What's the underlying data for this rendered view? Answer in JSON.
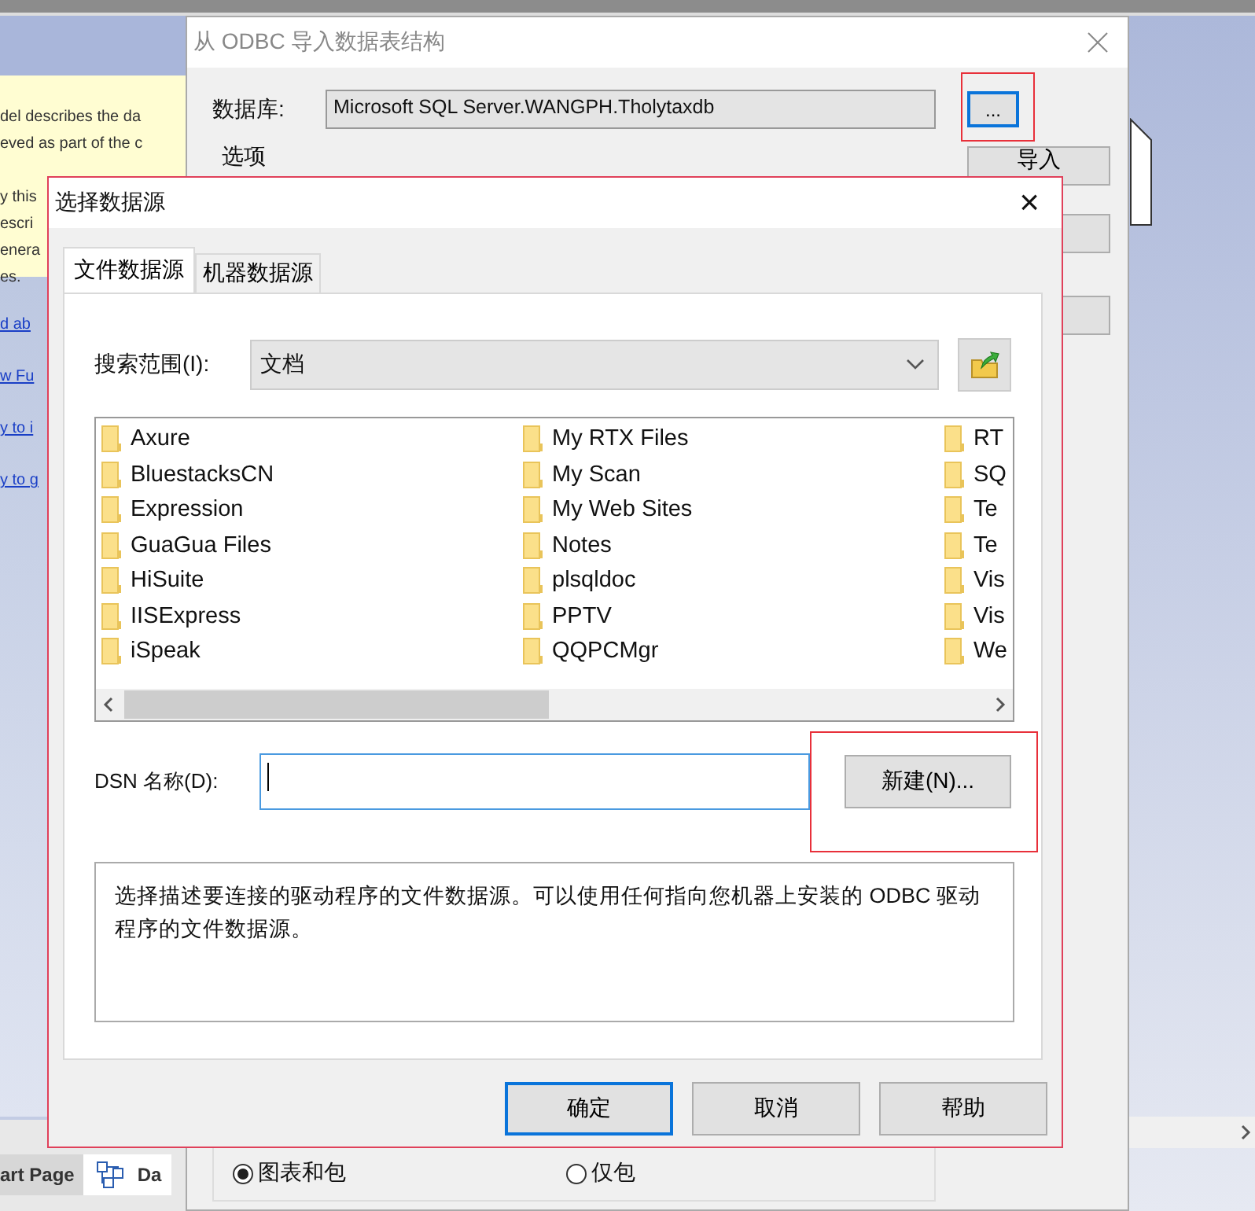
{
  "background_app": {
    "note_paragraphs": [
      [
        "del describes the da",
        "eved as part of the c"
      ],
      [
        "y this",
        "escri",
        "enera",
        "es."
      ]
    ],
    "links": [
      "d ab",
      "w Fu",
      "y to i",
      "y to g"
    ],
    "tabs": [
      {
        "label": "art Page",
        "selected": false
      },
      {
        "label": "Da",
        "selected": true
      }
    ]
  },
  "import_dialog": {
    "title": "从 ODBC 导入数据表结构",
    "database_label": "数据库:",
    "database_value": "Microsoft SQL Server.WANGPH.Tholytaxdb",
    "browse_button": "...",
    "options_label": "选项",
    "import_button": "导入",
    "radios": [
      {
        "label": "图表和包",
        "selected": true
      },
      {
        "label": "仅包",
        "selected": false
      }
    ]
  },
  "datasource_dialog": {
    "title": "选择数据源",
    "close": "×",
    "tabs": [
      {
        "label": "文件数据源",
        "selected": true
      },
      {
        "label": "机器数据源",
        "selected": false
      }
    ],
    "look_in_label": "搜索范围(I):",
    "look_in_value": "文档",
    "files": [
      "Axure",
      "BluestacksCN",
      "Expression",
      "GuaGua Files",
      "HiSuite",
      "IISExpress",
      "iSpeak",
      "My RTX Files",
      "My Scan",
      "My Web Sites",
      "Notes",
      "plsqldoc",
      "PPTV",
      "QQPCMgr",
      "RT",
      "SQ",
      "Te",
      "Te",
      "Vis",
      "Vis",
      "We"
    ],
    "dsn_label": "DSN 名称(D):",
    "new_button": "新建(N)...",
    "description": "选择描述要连接的驱动程序的文件数据源。可以使用任何指向您机器上安装的 ODBC 驱动程序的文件数据源。",
    "buttons": [
      {
        "label": "确定",
        "default": true
      },
      {
        "label": "取消",
        "default": false
      },
      {
        "label": "帮助",
        "default": false
      }
    ]
  }
}
